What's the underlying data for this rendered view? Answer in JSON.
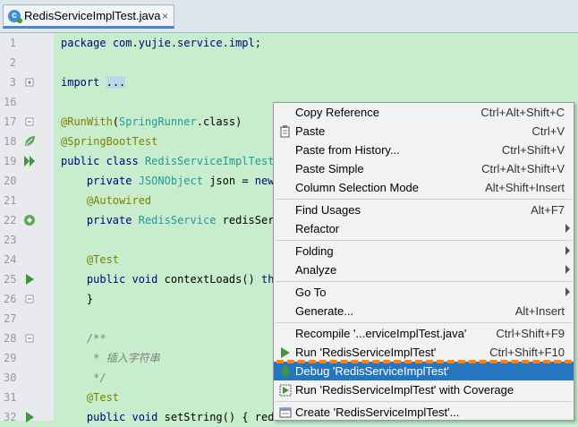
{
  "tab": {
    "title": "RedisServiceImplTest.java",
    "close": "×",
    "icon_letter": "c"
  },
  "gutter": {
    "lines": [
      "1",
      "2",
      "3",
      "16",
      "17",
      "18",
      "19",
      "20",
      "21",
      "22",
      "23",
      "24",
      "25",
      "26",
      "27",
      "28",
      "29",
      "30",
      "31",
      "32"
    ]
  },
  "code": {
    "l1_kw": "package",
    "l1_pkg": "com.yujie.service.impl;",
    "l3_kw": "import",
    "l3_fold": "...",
    "l17_ann": "@RunWith",
    "l17_rest1": "(",
    "l17_ty": "SpringRunner",
    "l17_rest2": ".class)",
    "l18_ann": "@SpringBootTest",
    "l19_kw": "public class",
    "l19_ty": "RedisServiceImplTest",
    "l20_kw": "private",
    "l20_ty": "JSONObject",
    "l20_rest": "json =",
    "l20_kw2": "new",
    "l21_ann": "@Autowired",
    "l22_kw": "private",
    "l22_ty": "RedisService",
    "l22_rest": "redisServ",
    "l24_ann": "@Test",
    "l25_kw": "public void",
    "l25_rest": "contextLoads()",
    "l25_kw2": "thr",
    "l26_rest": "}",
    "l28_cm": "/**",
    "l29_cm": " * 插入字符串",
    "l30_cm": " */",
    "l31_ann": "@Test",
    "l32_kw": "public void",
    "l32_rest": "setString() {",
    "l32_tail": "redi"
  },
  "menu": {
    "items": [
      {
        "label": "Copy Reference",
        "shortcut": "Ctrl+Alt+Shift+C"
      },
      {
        "label": "Paste",
        "shortcut": "Ctrl+V"
      },
      {
        "label": "Paste from History...",
        "shortcut": "Ctrl+Shift+V"
      },
      {
        "label": "Paste Simple",
        "shortcut": "Ctrl+Alt+Shift+V"
      },
      {
        "label": "Column Selection Mode",
        "shortcut": "Alt+Shift+Insert"
      },
      {
        "label": "Find Usages",
        "shortcut": "Alt+F7"
      },
      {
        "label": "Refactor",
        "shortcut": ""
      },
      {
        "label": "Folding",
        "shortcut": ""
      },
      {
        "label": "Analyze",
        "shortcut": ""
      },
      {
        "label": "Go To",
        "shortcut": ""
      },
      {
        "label": "Generate...",
        "shortcut": "Alt+Insert"
      },
      {
        "label": "Recompile '...erviceImplTest.java'",
        "shortcut": "Ctrl+Shift+F9"
      },
      {
        "label": "Run 'RedisServiceImplTest'",
        "shortcut": "Ctrl+Shift+F10"
      },
      {
        "label": "Debug 'RedisServiceImplTest'",
        "shortcut": ""
      },
      {
        "label": "Run 'RedisServiceImplTest' with Coverage",
        "shortcut": ""
      },
      {
        "label": "Create 'RedisServiceImplTest'...",
        "shortcut": ""
      }
    ]
  },
  "colors": {
    "selection": "#2675bf",
    "editor_bg": "#c7edcc",
    "highlight_dash": "#ff7f10"
  }
}
